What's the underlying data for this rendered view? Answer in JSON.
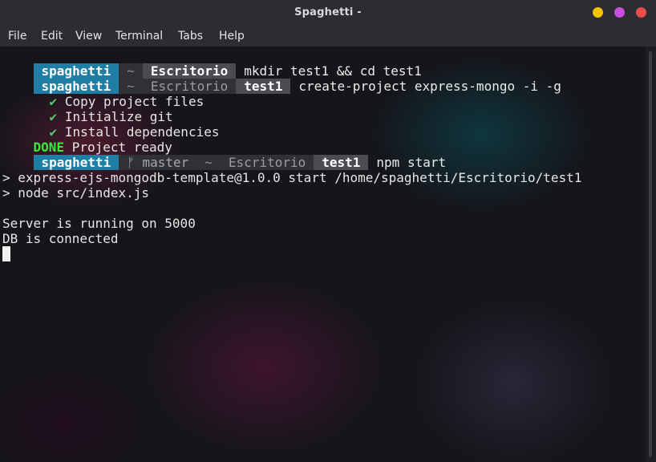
{
  "window": {
    "title": "Spaghetti -"
  },
  "menu": [
    "File",
    "Edit",
    "View",
    "Terminal",
    "Tabs",
    "Help"
  ],
  "prompt1": {
    "user": "spaghetti",
    "home": "~",
    "dir": "Escritorio",
    "command": "mkdir test1 && cd test1"
  },
  "prompt2": {
    "user": "spaghetti",
    "home": "~",
    "dir": "Escritorio",
    "cur": "test1",
    "command": "create-project express-mongo -i -g"
  },
  "steps": [
    {
      "check": "✔",
      "text": "Copy project files"
    },
    {
      "check": "✔",
      "text": "Initialize git"
    },
    {
      "check": "✔",
      "text": "Install dependencies"
    }
  ],
  "done": {
    "label": "DONE",
    "text": "Project ready"
  },
  "prompt3": {
    "user": "spaghetti",
    "git": "ᚠ master",
    "home": "~",
    "dir": "Escritorio",
    "cur": "test1",
    "command": "npm start"
  },
  "output": [
    "> express-ejs-mongodb-template@1.0.0 start /home/spaghetti/Escritorio/test1",
    "> node src/index.js",
    "Server is running on 5000",
    "DB is connected"
  ],
  "colors": {
    "user_segment": "#1f7ea6",
    "done": "#3ee63e",
    "check": "#4fd06b",
    "minimize": "#f5c400",
    "maximize": "#c94fe0",
    "close": "#ee4b4b"
  }
}
